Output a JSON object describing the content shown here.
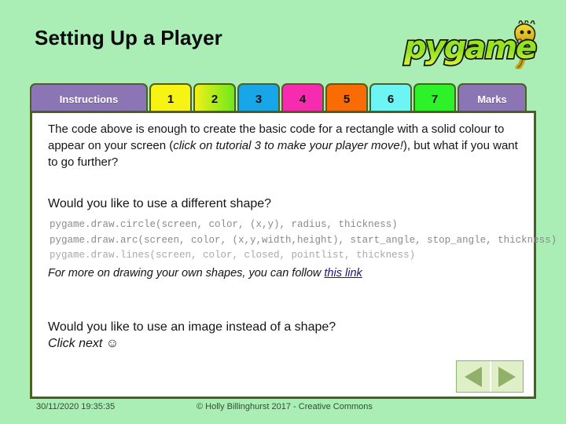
{
  "slide": {
    "title": "Setting Up a Player",
    "background_color": "#aaeeb5",
    "frame_border_color": "#4d5f22"
  },
  "logo": {
    "name": "pygame-logo",
    "wordmark": "pygame",
    "mascot": "snake-mascot"
  },
  "tabs": [
    {
      "label": "Instructions",
      "color": "#8b75b5",
      "name": "tab-instructions"
    },
    {
      "label": "1",
      "color": "#f7f315",
      "name": "tab-1"
    },
    {
      "label": "2",
      "color": "#b7f024",
      "name": "tab-2"
    },
    {
      "label": "3",
      "color": "#18a6e8",
      "name": "tab-3"
    },
    {
      "label": "4",
      "color": "#f72bb0",
      "name": "tab-4"
    },
    {
      "label": "5",
      "color": "#f96b05",
      "name": "tab-5"
    },
    {
      "label": "6",
      "color": "#6df5f5",
      "name": "tab-6"
    },
    {
      "label": "7",
      "color": "#2ef229",
      "name": "tab-7"
    },
    {
      "label": "Marks",
      "color": "#8b75b5",
      "name": "tab-marks"
    }
  ],
  "content": {
    "paragraph_1_part_1": "The code above is enough to create the basic code for a rectangle with a solid colour to appear on your screen (",
    "paragraph_1_italic": "click on tutorial 3 to make your player move!",
    "paragraph_1_part_2": "), but what if you want to go further?",
    "heading_shape": "Would you like to use a different shape?",
    "code_lines": [
      "pygame.draw.circle(screen, color, (x,y), radius, thickness)",
      "pygame.draw.arc(screen, color, (x,y,width,height), start_angle, stop_angle, thickness)",
      "pygame.draw.lines(screen, color, closed, pointlist, thickness)"
    ],
    "link_prefix": "For more on drawing your own shapes, you can follow ",
    "link_text": "this link",
    "heading_image": "Would you like to use an image instead of a shape?",
    "click_next": "Click next ☺"
  },
  "nav": {
    "previous_icon": "triangle-left-icon",
    "next_icon": "triangle-right-icon"
  },
  "footer": {
    "date": "30/11/2020 19:35:35",
    "copyright": "© Holly Billinghurst 2017 - Creative Commons"
  }
}
